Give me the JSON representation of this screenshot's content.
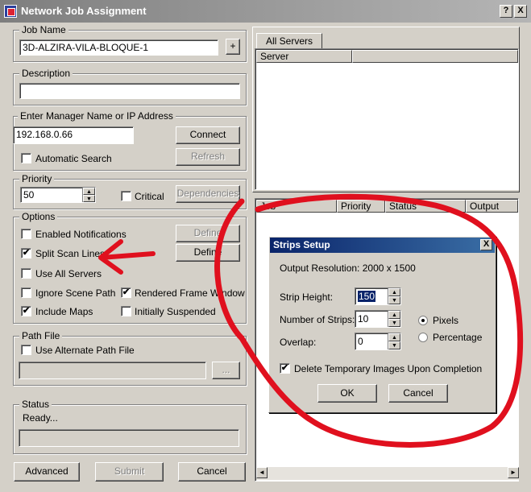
{
  "window": {
    "title": "Network Job Assignment",
    "help_glyph": "?",
    "close_glyph": "X"
  },
  "job_name": {
    "legend": "Job Name",
    "value": "3D-ALZIRA-VILA-BLOQUE-1",
    "plus_label": "+"
  },
  "description": {
    "legend": "Description",
    "value": ""
  },
  "manager": {
    "legend": "Enter Manager Name or IP Address",
    "value": "192.168.0.66",
    "connect_label": "Connect",
    "auto_search_label": "Automatic Search",
    "refresh_label": "Refresh"
  },
  "priority": {
    "legend": "Priority",
    "value": "50",
    "critical_label": "Critical",
    "dependencies_label": "Dependencies"
  },
  "options": {
    "legend": "Options",
    "enabled_notifications": "Enabled Notifications",
    "define1": "Define",
    "split_scan_lines": "Split Scan Lines",
    "define2": "Define",
    "use_all_servers": "Use All Servers",
    "ignore_scene_path": "Ignore Scene Path",
    "rendered_frame_window": "Rendered Frame Window",
    "include_maps": "Include Maps",
    "initially_suspended": "Initially Suspended",
    "check_glyph": "✔"
  },
  "path_file": {
    "legend": "Path File",
    "use_alternate": "Use Alternate Path File",
    "value": "",
    "browse_label": "..."
  },
  "status": {
    "legend": "Status",
    "text": "Ready..."
  },
  "bottom": {
    "advanced": "Advanced",
    "submit": "Submit",
    "cancel": "Cancel"
  },
  "servers": {
    "tab": "All Servers",
    "col_server": "Server"
  },
  "jobs": {
    "col_job": "Job",
    "col_priority": "Priority",
    "col_status": "Status",
    "col_output": "Output"
  },
  "strips": {
    "title": "Strips Setup",
    "close_glyph": "X",
    "resolution": "Output Resolution: 2000 x 1500",
    "strip_height_label": "Strip Height:",
    "strip_height": "150",
    "num_strips_label": "Number of Strips:",
    "num_strips": "10",
    "overlap_label": "Overlap:",
    "overlap": "0",
    "pixels": "Pixels",
    "percentage": "Percentage",
    "delete_temp": "Delete Temporary Images Upon Completion",
    "ok": "OK",
    "cancel": "Cancel"
  },
  "icons": {
    "spin_up": "▲",
    "spin_down": "▼",
    "scroll_left": "◄",
    "scroll_right": "►"
  },
  "colors": {
    "annotation": "#e0101e"
  }
}
